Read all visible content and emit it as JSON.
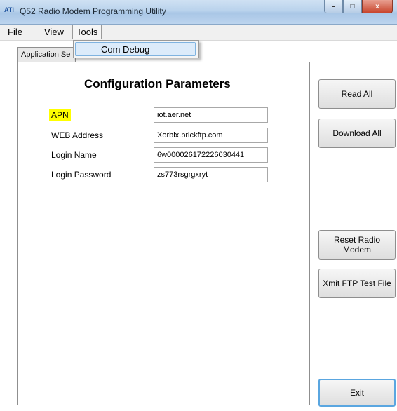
{
  "window": {
    "title": "Q52 Radio Modem Programming Utility",
    "icon_text": "ATI"
  },
  "window_controls": {
    "minimize": "–",
    "maximize": "□",
    "close": "x"
  },
  "menubar": {
    "file": "File",
    "view": "View",
    "tools": "Tools"
  },
  "tools_menu": {
    "com_debug": "Com Debug"
  },
  "tab": {
    "label": "Application Se"
  },
  "panel": {
    "title": "Configuration Parameters",
    "fields": [
      {
        "label": "APN",
        "value": "iot.aer.net"
      },
      {
        "label": "WEB Address",
        "value": "Xorbix.brickftp.com"
      },
      {
        "label": "Login Name",
        "value": "6w000026172226030441"
      },
      {
        "label": "Login Password",
        "value": "zs773rsgrgxryt"
      }
    ]
  },
  "buttons": {
    "read_all": "Read All",
    "download_all": "Download All",
    "reset_radio_modem": "Reset Radio Modem",
    "xmit_ftp_test_file": "Xmit FTP Test File",
    "exit": "Exit"
  },
  "colors": {
    "highlight": "#ffff00",
    "menu_hover": "#dcebfa",
    "close_button": "#c8452d"
  }
}
